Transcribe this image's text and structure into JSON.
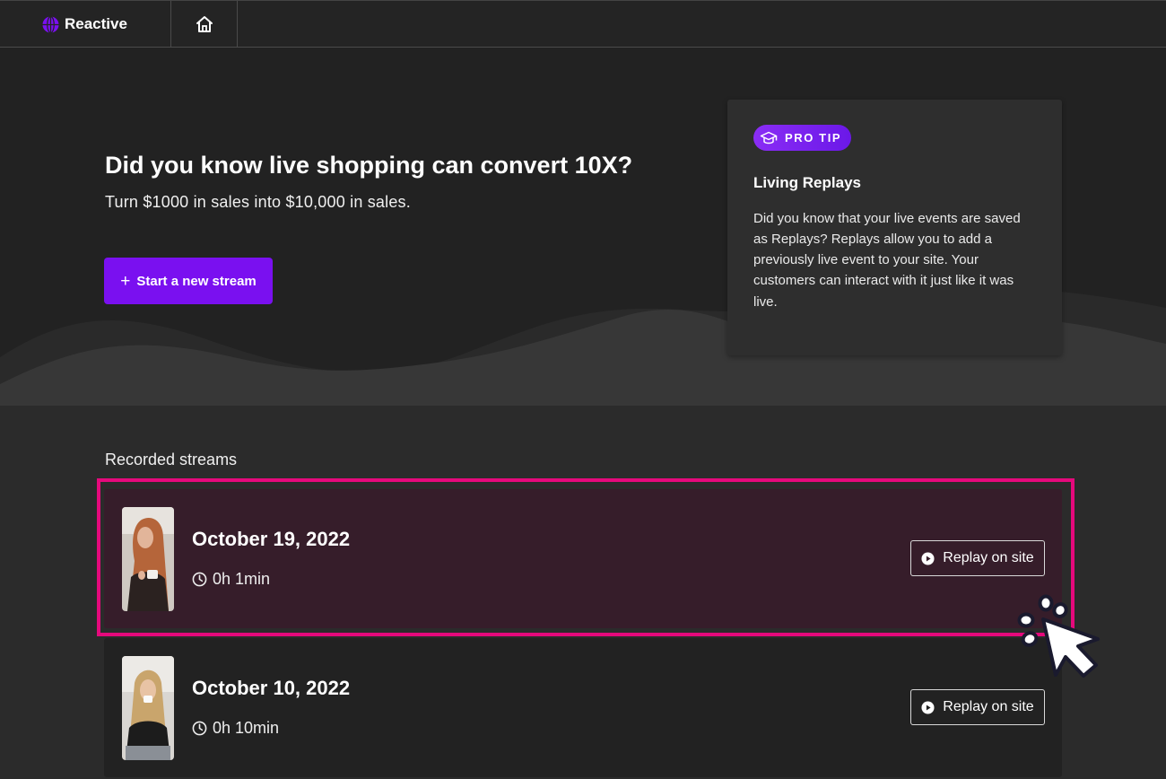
{
  "app": {
    "brand_name": "Reactive",
    "brand_color": "#7a10f0",
    "logo_icon": "globe-icon",
    "home_icon": "home-icon"
  },
  "hero": {
    "title": "Did you know live shopping can convert 10X?",
    "subtitle": "Turn $1000 in sales into $10,000 in sales.",
    "start_button": {
      "icon": "+",
      "label": "Start a new stream"
    }
  },
  "pro_tip": {
    "badge_icon": "graduation-cap-icon",
    "badge": "PRO TIP",
    "title": "Living Replays",
    "body": "Did you know that your live events are saved as Replays? Replays allow you to add a previously live event to your site. Your customers can interact with it just like it was live."
  },
  "recorded": {
    "label": "Recorded streams",
    "streams": [
      {
        "date": "October 19, 2022",
        "duration": "0h 1min",
        "button_label": "Replay on site",
        "highlighted": true
      },
      {
        "date": "October 10, 2022",
        "duration": "0h 10min",
        "button_label": "Replay on site",
        "highlighted": false
      }
    ]
  },
  "colors": {
    "accent": "#7a10f0",
    "highlight": "#e5097c",
    "highlight_row_bg": "#361d2a"
  }
}
